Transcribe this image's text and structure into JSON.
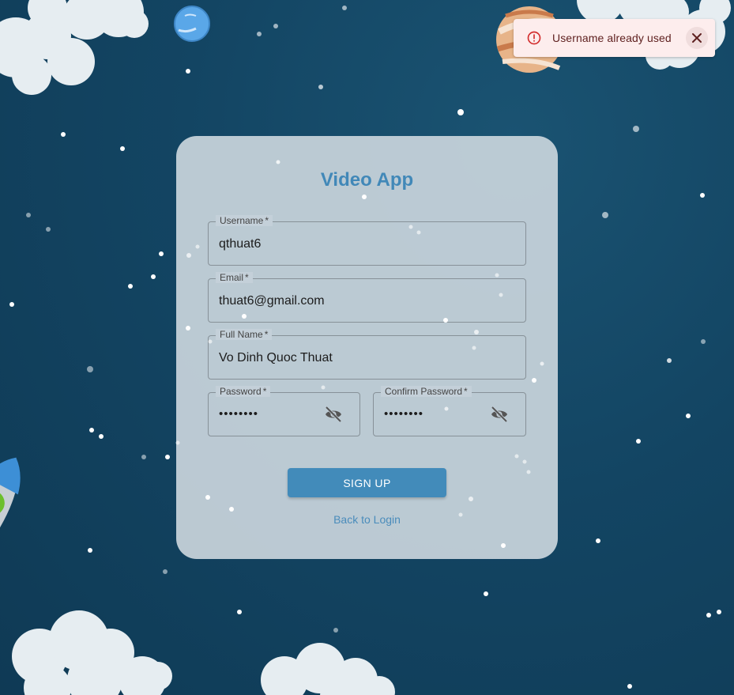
{
  "toast": {
    "message": "Username already used",
    "severity": "error",
    "icon": "error-outline-icon",
    "close_icon": "close-icon"
  },
  "card": {
    "title": "Video App"
  },
  "fields": {
    "username": {
      "label": "Username",
      "required_mark": "*",
      "value": "qthuat6"
    },
    "email": {
      "label": "Email",
      "required_mark": "*",
      "value": "thuat6@gmail.com"
    },
    "full_name": {
      "label": "Full Name",
      "required_mark": "*",
      "value": "Vo Dinh Quoc Thuat"
    },
    "password": {
      "label": "Password",
      "required_mark": "*",
      "value": "••••••••",
      "icon": "visibility-off-icon"
    },
    "confirm_password": {
      "label": "Confirm Password",
      "required_mark": "*",
      "value": "••••••••",
      "icon": "visibility-off-icon"
    }
  },
  "actions": {
    "sign_up_label": "SIGN UP",
    "back_label": "Back to Login"
  },
  "colors": {
    "background": "#134563",
    "accent": "#428bba",
    "title": "#4188b8",
    "toast_bg": "#fdeded",
    "toast_text": "#5f2120",
    "error": "#d32f2f"
  }
}
